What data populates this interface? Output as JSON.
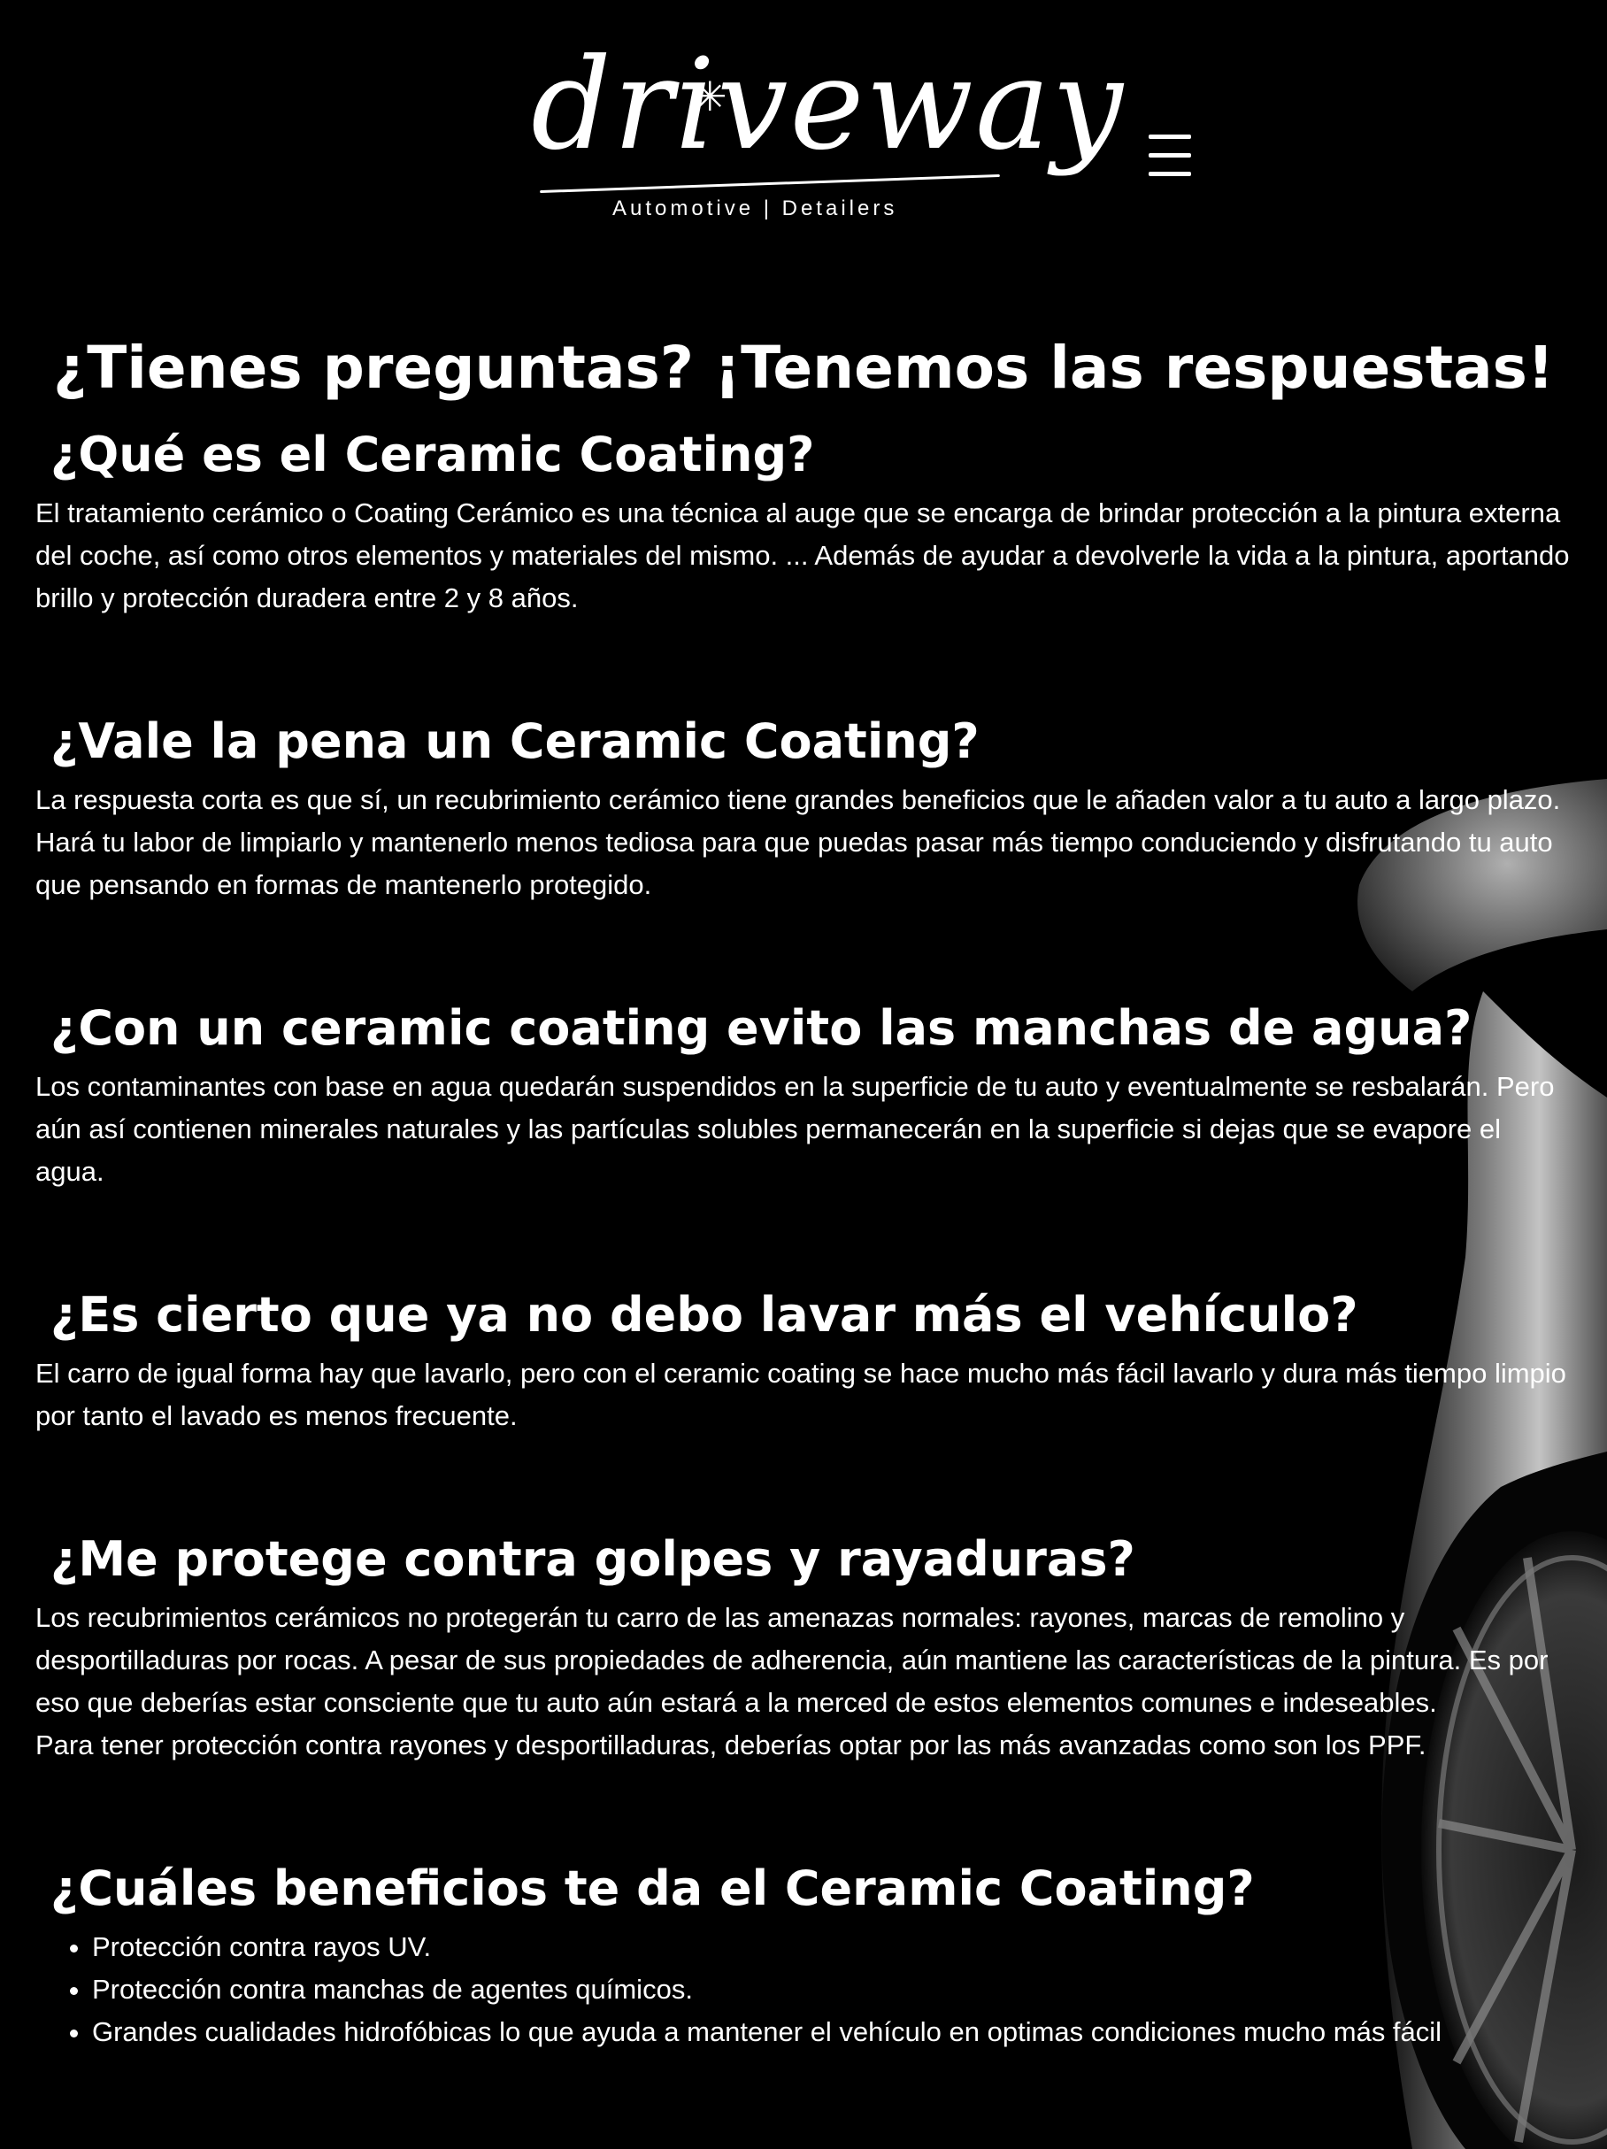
{
  "header": {
    "logo_script": "driveway",
    "logo_tagline": "Automotive | Detailers",
    "menu_icon": "hamburger-menu-icon"
  },
  "page": {
    "title": "¿Tienes preguntas? ¡Tenemos las respuestas!"
  },
  "faqs": [
    {
      "question": "¿Qué es el Ceramic Coating?",
      "answer": [
        "El tratamiento cerámico o Coating Cerámico es una técnica al auge que se encarga de brindar protección a la pintura externa del coche, así como otros elementos y materiales del mismo. ... Además de ayudar a devolverle la vida a la pintura, aportando brillo y protección duradera entre 2 y 8 años."
      ]
    },
    {
      "question": "¿Vale la pena un Ceramic Coating?",
      "answer": [
        "La respuesta corta es que sí, un recubrimiento cerámico tiene grandes beneficios que le añaden valor a tu auto a largo plazo. Hará tu labor de limpiarlo y mantenerlo menos tediosa para que puedas pasar más tiempo conduciendo y disfrutando tu auto que pensando en formas de mantenerlo protegido."
      ]
    },
    {
      "question": "¿Con un ceramic coating evito las manchas de agua?",
      "answer": [
        "Los contaminantes con base en agua quedarán suspendidos en la superficie de tu auto y eventualmente se resbalarán. Pero aún así contienen minerales naturales y las partículas solubles permanecerán en la superficie si dejas que se evapore el agua."
      ]
    },
    {
      "question": "¿Es cierto que ya no debo lavar más el vehículo?",
      "answer": [
        "El carro de igual forma hay que lavarlo, pero con el ceramic coating se hace mucho más fácil lavarlo y dura más tiempo limpio por tanto el lavado es menos frecuente."
      ]
    },
    {
      "question": "¿Me protege contra golpes y rayaduras?",
      "answer": [
        "Los recubrimientos cerámicos no protegerán tu carro de las amenazas normales: rayones, marcas de remolino y desportilladuras por rocas. A pesar de sus propiedades de adherencia, aún mantiene las características de la pintura. Es por eso que deberías estar consciente que tu auto aún estará a la merced de estos elementos comunes e indeseables.",
        "Para tener protección contra rayones y desportilladuras, deberías optar por las más avanzadas como son los PPF."
      ]
    },
    {
      "question": "¿Cuáles beneficios te da el Ceramic Coating?",
      "list": [
        "Protección contra rayos UV.",
        "Protección contra manchas de agentes químicos.",
        "Grandes cualidades hidrofóbicas lo que ayuda a mantener el vehículo en optimas condiciones mucho más fácil"
      ]
    }
  ]
}
